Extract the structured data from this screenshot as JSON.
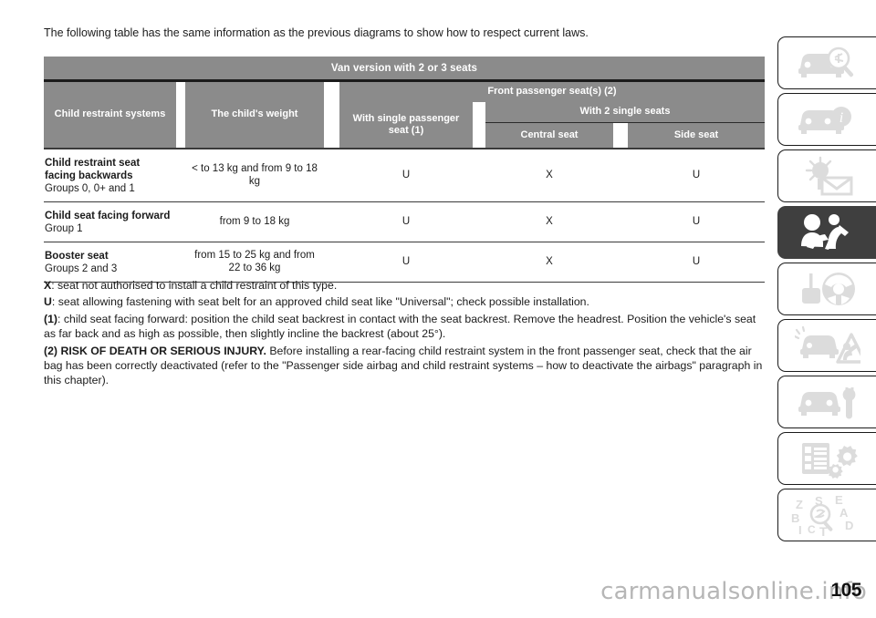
{
  "intro": "The following table has the same information as the previous diagrams to show how to respect current laws.",
  "table": {
    "top_title": "Van version with 2 or 3 seats",
    "headers": {
      "child_restraint_systems": "Child restraint systems",
      "child_weight": "The child's weight",
      "front_passenger_seats": "Front passenger seat(s) (2)",
      "with_single_passenger_seat": "With single passenger seat (1)",
      "with_2_single_seats": "With 2 single seats",
      "central_seat": "Central seat",
      "side_seat": "Side seat"
    },
    "rows": [
      {
        "system_bold": "Child restraint seat facing backwards",
        "system_regular": "Groups 0, 0+ and 1",
        "weight": "< to 13 kg and from 9 to 18 kg",
        "single_passenger": "U",
        "central": "X",
        "side": "U"
      },
      {
        "system_bold": "Child seat facing forward",
        "system_regular": "Group 1",
        "weight": "from 9 to 18 kg",
        "single_passenger": "U",
        "central": "X",
        "side": "U"
      },
      {
        "system_bold": "Booster seat",
        "system_regular": "Groups 2 and 3",
        "weight": "from 15 to 25 kg and from 22 to 36 kg",
        "single_passenger": "U",
        "central": "X",
        "side": "U"
      }
    ]
  },
  "notes": {
    "x_key": "X",
    "x_text": ": seat not authorised to install a child restraint of this type.",
    "u_key": "U",
    "u_text": ": seat allowing fastening with seat belt for an approved child seat like \"Universal\"; check possible installation.",
    "n1_key": "(1)",
    "n1_text": ": child seat facing forward: position the child seat backrest in contact with the seat backrest. Remove the headrest. Position the vehicle's seat as far back and as high as possible, then slightly incline the backrest (about 25°).",
    "n2_key": "(2) RISK OF DEATH OR SERIOUS INJURY.",
    "n2_text": " Before installing a rear-facing child restraint system in the front passenger seat, check that the air bag has been correctly deactivated (refer to the \"Passenger side airbag and child restraint systems – how to deactivate the airbags\" paragraph in this chapter)."
  },
  "rail": {
    "tabs": [
      {
        "icon": "car-inspection-icon",
        "active": false
      },
      {
        "icon": "car-info-icon",
        "active": false
      },
      {
        "icon": "dashboard-warning-light-icon",
        "active": false
      },
      {
        "icon": "child-seat-safety-icon",
        "active": true
      },
      {
        "icon": "steering-wheel-key-icon",
        "active": false
      },
      {
        "icon": "emergency-breakdown-icon",
        "active": false
      },
      {
        "icon": "car-maintenance-wrench-icon",
        "active": false
      },
      {
        "icon": "technical-specifications-icon",
        "active": false
      },
      {
        "icon": "alphabetical-index-icon",
        "active": false
      }
    ],
    "index_letters": [
      "Z",
      "S",
      "E",
      "B",
      "A",
      "I",
      "C",
      "T",
      "D"
    ]
  },
  "footer": {
    "page_number": "105",
    "watermark": "carmanualsonline.info"
  },
  "colors": {
    "header_gray": "#8b8b8b",
    "active_tab": "#3f3f3f",
    "rule_dark": "#1b1b1b",
    "icon_gray": "#dcdcdc"
  }
}
